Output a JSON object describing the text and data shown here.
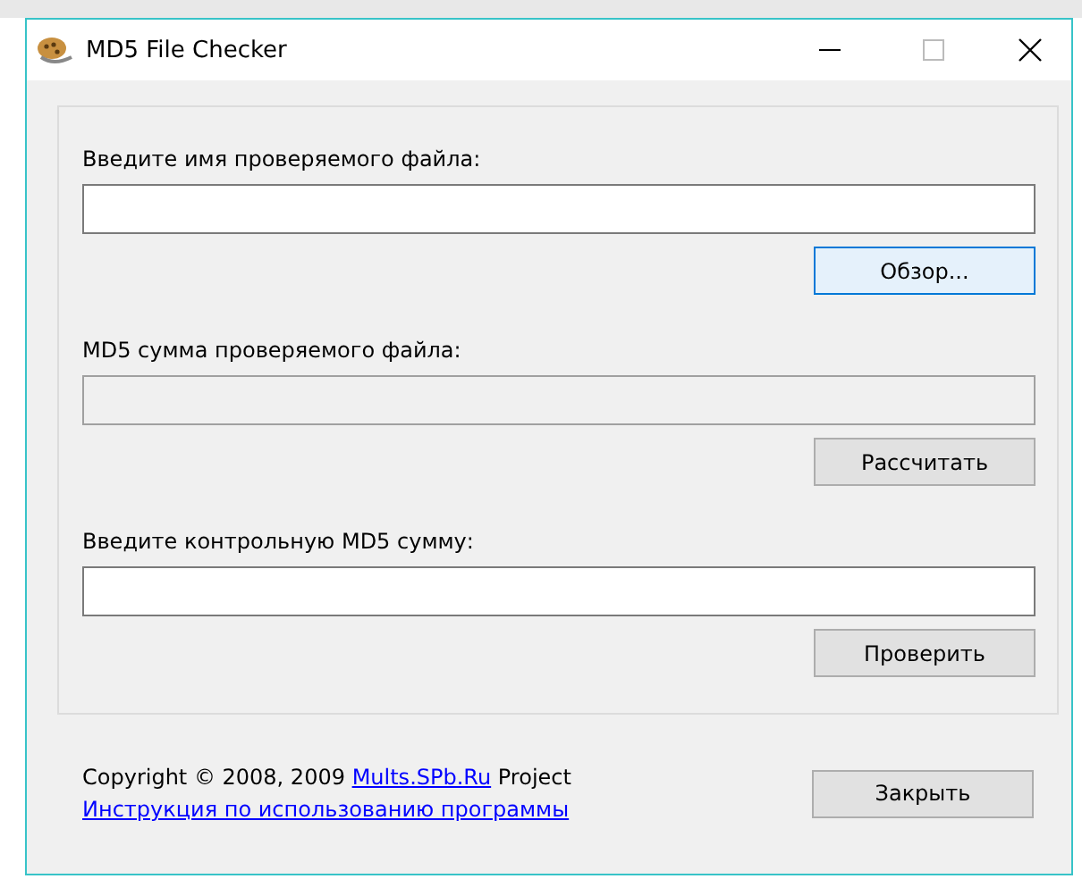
{
  "window": {
    "title": "MD5 File Checker"
  },
  "sections": [
    {
      "label": "Введите имя проверяемого файла:",
      "field": {
        "readonly": false
      },
      "button": {
        "label": "Обзор...",
        "focused": true
      }
    },
    {
      "label": "MD5 сумма проверяемого файла:",
      "field": {
        "readonly": true
      },
      "button": {
        "label": "Рассчитать",
        "focused": false
      }
    },
    {
      "label": "Введите контрольную MD5 сумму:",
      "field": {
        "readonly": false
      },
      "button": {
        "label": "Проверить",
        "focused": false
      }
    }
  ],
  "footer": {
    "copyright_before": "Copyright © 2008, 2009",
    "site_link": "Mults.SPb.Ru",
    "copyright_after": "Project",
    "help_link": "Инструкция по использованию программы",
    "close_button": "Закрыть"
  }
}
